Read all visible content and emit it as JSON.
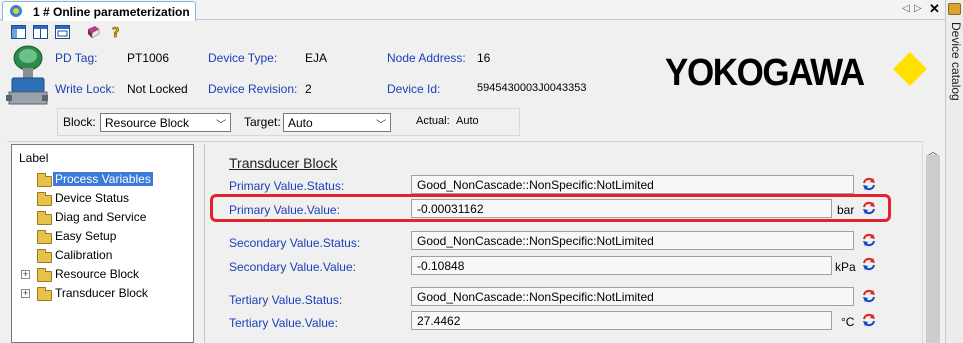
{
  "tab": {
    "title": "1 # Online parameterization"
  },
  "catalog": {
    "label": "Device catalog"
  },
  "toolbar": {
    "icons": [
      "layout-one-icon",
      "layout-two-icon",
      "layout-three-icon",
      "book-icon",
      "help-icon"
    ]
  },
  "device": {
    "pd_tag_label": "PD Tag:",
    "pd_tag_value": "PT1006",
    "device_type_label": "Device Type:",
    "device_type_value": "EJA",
    "node_address_label": "Node Address:",
    "node_address_value": "16",
    "write_lock_label": "Write Lock:",
    "write_lock_value": "Not Locked",
    "device_revision_label": "Device Revision:",
    "device_revision_value": "2",
    "device_id_label": "Device Id:",
    "device_id_value": "5945430003J0043353"
  },
  "logo": {
    "text": "YOKOGAWA",
    "diamond_color": "#ffe100"
  },
  "block_bar": {
    "block_label": "Block:",
    "block_value": "Resource Block",
    "target_label": "Target:",
    "target_value": "Auto",
    "actual_label": "Actual:",
    "actual_value": "Auto"
  },
  "tree": {
    "header": "Label",
    "items": [
      {
        "label": "Process Variables",
        "selected": true
      },
      {
        "label": "Device Status"
      },
      {
        "label": "Diag and Service"
      },
      {
        "label": "Easy Setup"
      },
      {
        "label": "Calibration"
      },
      {
        "label": "Resource Block",
        "expander": "+"
      },
      {
        "label": "Transducer Block",
        "expander": "+"
      }
    ]
  },
  "form": {
    "section_title": "Transducer Block",
    "params": [
      {
        "label": "Primary Value.Status:",
        "value": "Good_NonCascade::NonSpecific:NotLimited",
        "unit": ""
      },
      {
        "label": "Primary Value.Value:",
        "value": "-0.00031162",
        "unit": "bar"
      },
      {
        "label": "Secondary Value.Status:",
        "value": "Good_NonCascade::NonSpecific:NotLimited",
        "unit": ""
      },
      {
        "label": "Secondary Value.Value:",
        "value": "-0.10848",
        "unit": "kPa"
      },
      {
        "label": "Tertiary Value.Status:",
        "value": "Good_NonCascade::NonSpecific:NotLimited",
        "unit": ""
      },
      {
        "label": "Tertiary Value.Value:",
        "value": "27.4462",
        "unit": "°C"
      }
    ]
  },
  "colors": {
    "label_blue": "#1b3fb8",
    "highlight_red": "#e3242b",
    "selection_blue": "#3b7ad8"
  }
}
